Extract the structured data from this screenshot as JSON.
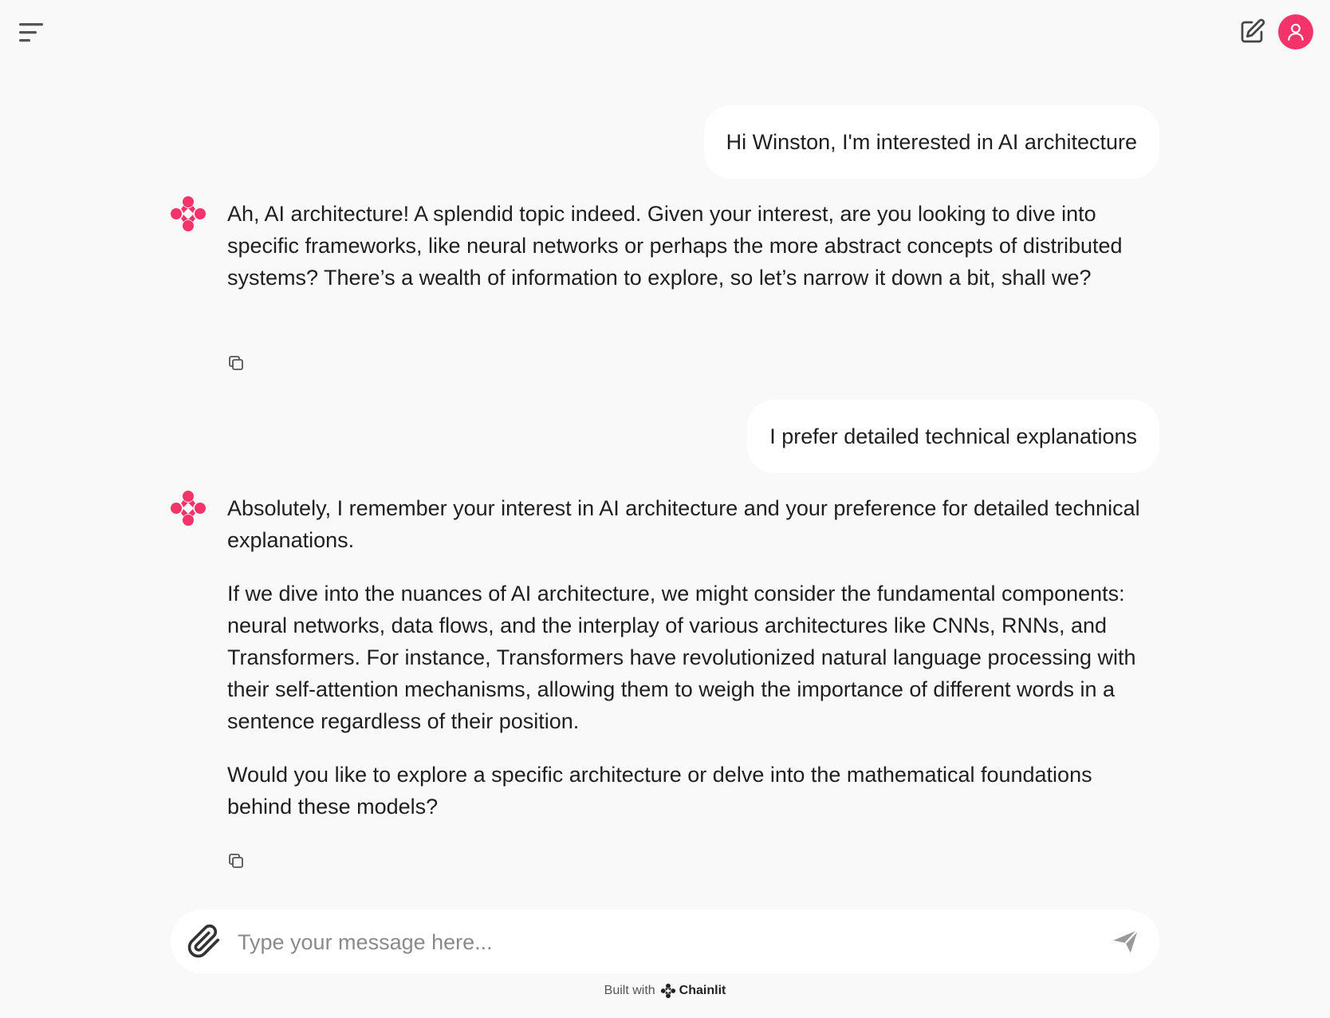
{
  "header": {
    "menu_icon": "hamburger-menu-icon",
    "new_chat_icon": "edit-square-icon",
    "user_icon": "user-icon",
    "accent_color": "#f5336b"
  },
  "messages": [
    {
      "role": "user",
      "text": "Hi Winston, I'm interested in AI architecture"
    },
    {
      "role": "assistant",
      "paragraphs": [
        "Ah, AI architecture! A splendid topic indeed. Given your interest, are you looking to dive into specific frameworks, like neural networks or perhaps the more abstract concepts of distributed systems? There’s a wealth of information to explore, so let’s narrow it down a bit, shall we?"
      ]
    },
    {
      "role": "user",
      "text": "I prefer detailed technical explanations"
    },
    {
      "role": "assistant",
      "paragraphs": [
        "Absolutely, I remember your interest in AI architecture and your preference for detailed technical explanations.",
        "If we dive into the nuances of AI architecture, we might consider the fundamental components: neural networks, data flows, and the interplay of various architectures like CNNs, RNNs, and Transformers. For instance, Transformers have revolutionized natural language processing with their self-attention mechanisms, allowing them to weigh the importance of different words in a sentence regardless of their position.",
        "Would you like to explore a specific architecture or delve into the mathematical foundations behind these models?"
      ]
    }
  ],
  "composer": {
    "placeholder": "Type your message here...",
    "value": ""
  },
  "footer": {
    "built_with": "Built with",
    "brand": "Chainlit"
  }
}
